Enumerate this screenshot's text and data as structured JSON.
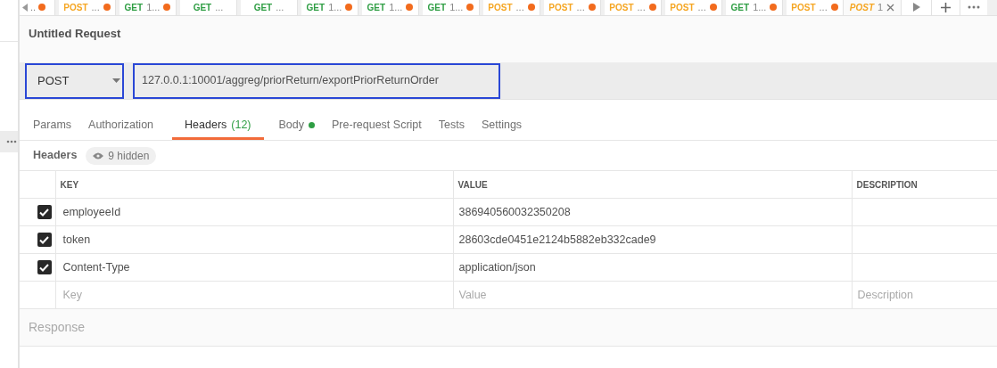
{
  "request_tabs": [
    {
      "method": "POST",
      "name": "...",
      "unsaved": true,
      "selected": false
    },
    {
      "method": "GET",
      "name": "1...",
      "unsaved": true,
      "selected": false
    },
    {
      "method": "GET",
      "name": "...",
      "unsaved": false,
      "selected": false
    },
    {
      "method": "GET",
      "name": "...",
      "unsaved": false,
      "selected": false
    },
    {
      "method": "GET",
      "name": "1...",
      "unsaved": true,
      "selected": false
    },
    {
      "method": "GET",
      "name": "1...",
      "unsaved": true,
      "selected": false
    },
    {
      "method": "GET",
      "name": "1...",
      "unsaved": true,
      "selected": false
    },
    {
      "method": "POST",
      "name": "...",
      "unsaved": true,
      "selected": false
    },
    {
      "method": "POST",
      "name": "...",
      "unsaved": true,
      "selected": false
    },
    {
      "method": "POST",
      "name": "...",
      "unsaved": true,
      "selected": false
    },
    {
      "method": "POST",
      "name": "...",
      "unsaved": true,
      "selected": false
    },
    {
      "method": "GET",
      "name": "1...",
      "unsaved": true,
      "selected": false
    },
    {
      "method": "POST",
      "name": "...",
      "unsaved": true,
      "selected": false
    },
    {
      "method": "POST",
      "name": "1",
      "unsaved": false,
      "selected": true
    }
  ],
  "first_tab": {
    "name": "..",
    "unsaved": true
  },
  "request_title": "Untitled Request",
  "url_bar": {
    "method": "POST",
    "url": "127.0.0.1:10001/aggreg/priorReturn/exportPriorReturnOrder"
  },
  "section_tabs": [
    {
      "label": "Params",
      "selected": false
    },
    {
      "label": "Authorization",
      "selected": false
    },
    {
      "label": "Headers",
      "count": "(12)",
      "selected": true
    },
    {
      "label": "Body",
      "has_content": true,
      "selected": false
    },
    {
      "label": "Pre-request Script",
      "selected": false
    },
    {
      "label": "Tests",
      "selected": false
    },
    {
      "label": "Settings",
      "selected": false
    }
  ],
  "headers": {
    "title": "Headers",
    "hidden_badge": "9 hidden",
    "columns": [
      "KEY",
      "VALUE",
      "DESCRIPTION"
    ],
    "rows": [
      {
        "checked": true,
        "key": "employeeId",
        "value": "386940560032350208"
      },
      {
        "checked": true,
        "key": "token",
        "value": "28603cde0451e2124b5882eb332cade9"
      },
      {
        "checked": true,
        "key": "Content-Type",
        "value": "application/json"
      }
    ],
    "new_row": {
      "key": {
        "placeholder": "Key"
      },
      "value": {
        "placeholder": "Value"
      },
      "description": {
        "placeholder": "Description"
      }
    }
  },
  "response_title": "Response"
}
